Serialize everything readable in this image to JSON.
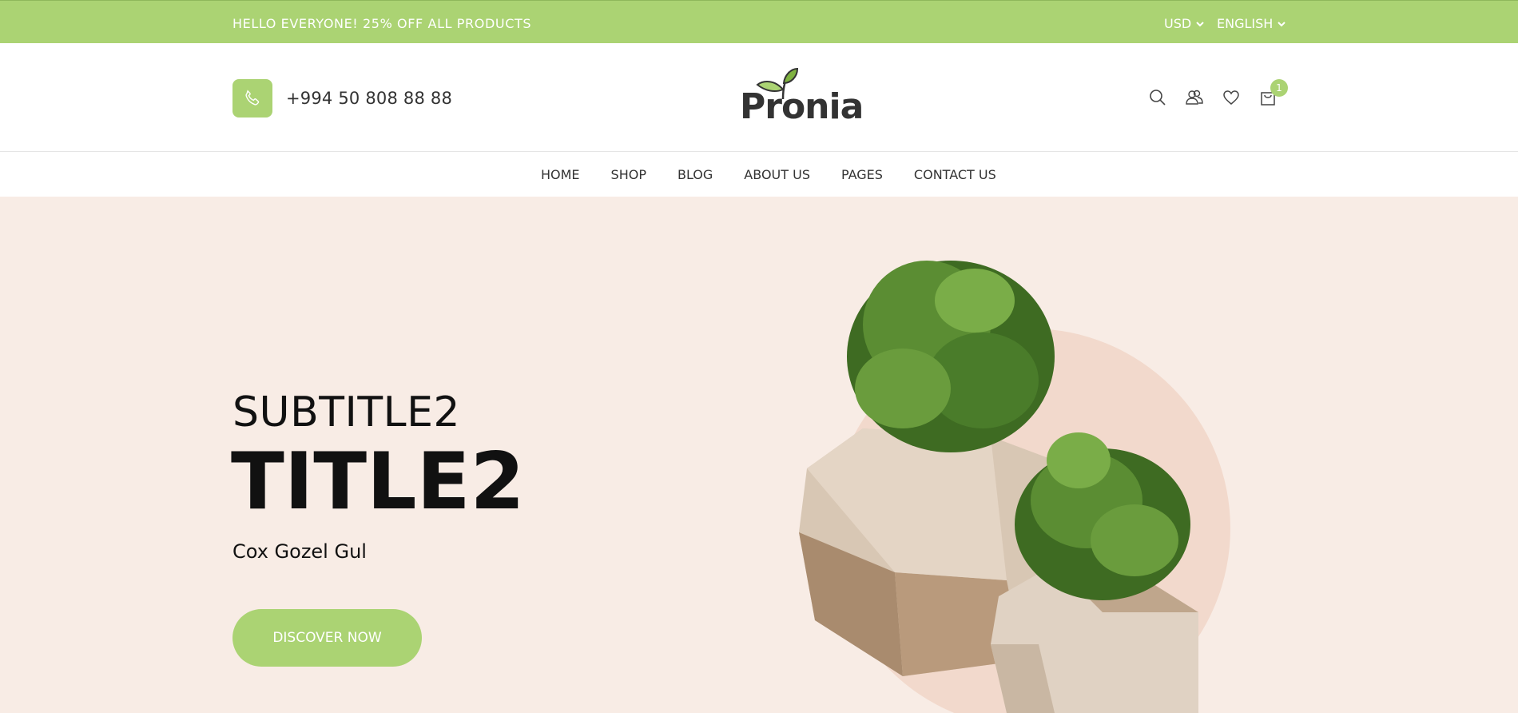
{
  "topbar": {
    "promo": "HELLO EVERYONE! 25% OFF ALL PRODUCTS",
    "currency": "USD",
    "language": "ENGLISH",
    "background": "#abd373"
  },
  "header": {
    "phone": "+994 50 808 88 88",
    "logo": "Pronia",
    "cart_count": "1",
    "icons": [
      "search-icon",
      "user-icon",
      "heart-icon",
      "cart-icon"
    ]
  },
  "nav": {
    "items": [
      "HOME",
      "SHOP",
      "BLOG",
      "ABOUT US",
      "PAGES",
      "CONTACT US"
    ]
  },
  "hero": {
    "subtitle": "SUBTITLE2",
    "title": "TITLE2",
    "description": "Cox Gozel Gul",
    "cta_label": "DISCOVER NOW",
    "background": "#f8ece5",
    "accent": "#abd373"
  }
}
